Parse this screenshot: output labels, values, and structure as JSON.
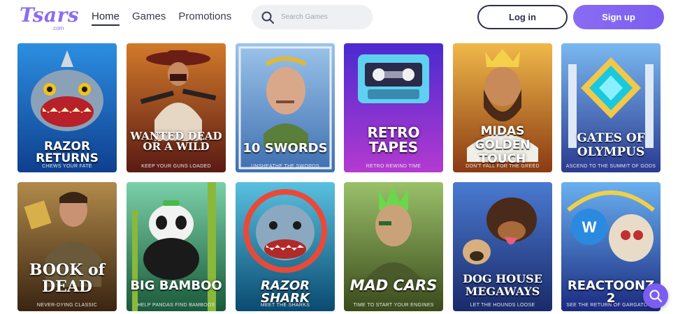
{
  "brand": {
    "logo": "Tsars",
    "logo_sub": ".com",
    "accent": "#8b6cf0"
  },
  "nav": [
    {
      "label": "Home",
      "active": true
    },
    {
      "label": "Games",
      "active": false
    },
    {
      "label": "Promotions",
      "active": false
    }
  ],
  "search": {
    "placeholder": "Search Games",
    "icon": "search-icon"
  },
  "auth": {
    "login_label": "Log in",
    "signup_label": "Sign up"
  },
  "games": [
    {
      "title": "RAZOR RETURNS",
      "tagline": "CHEWS YOUR FATE",
      "bg": "#1e6fc4"
    },
    {
      "title": "WANTED DEAD OR A WILD",
      "tagline": "KEEP YOUR GUNS LOADED",
      "bg": "#8a2d20"
    },
    {
      "title": "10 SWORDS",
      "tagline": "UNSHEATHE THE SWORDS",
      "bg": "#5a8fc8"
    },
    {
      "title": "RETRO TAPES",
      "tagline": "RETRO REWIND TIME",
      "bg": "#6b2fd1"
    },
    {
      "title": "MIDAS GOLDEN TOUCH",
      "tagline": "DON'T FALL FOR THE GREED",
      "bg": "#b5661c"
    },
    {
      "title": "GATES OF OLYMPUS",
      "tagline": "ASCEND TO THE SUMMIT OF GODS",
      "bg": "#3a58b8"
    },
    {
      "title": "BOOK of DEAD",
      "tagline": "NEVER-DYING CLASSIC",
      "bg": "#6b4424"
    },
    {
      "title": "BIG BAMBOO",
      "tagline": "HELP PANDAS FIND BAMBOOS",
      "bg": "#2f8a6a"
    },
    {
      "title": "RAZOR SHARK",
      "tagline": "MEET THE SHARKS",
      "bg": "#1c7fa8"
    },
    {
      "title": "MAD CARS",
      "tagline": "TIME TO START YOUR ENGINES",
      "bg": "#4f6b2a"
    },
    {
      "title": "DOG HOUSE MEGAWAYS",
      "tagline": "LET THE HOUNDS LOOSE",
      "bg": "#2b4a9a"
    },
    {
      "title": "REACTOONZ 2",
      "tagline": "SEE THE RETURN OF GARGATOON",
      "bg": "#2a4fb0"
    }
  ],
  "chat": {
    "icon": "chat-search-icon"
  }
}
